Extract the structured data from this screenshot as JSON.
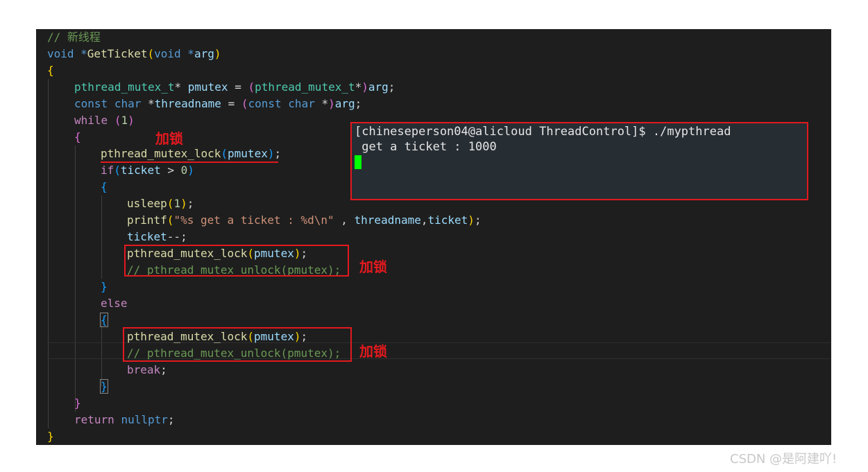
{
  "code": {
    "comment_new_thread": "// 新线程",
    "sig": [
      "void",
      " *",
      "GetTicket",
      "(",
      "void",
      " *",
      "arg",
      ")"
    ],
    "open_brace": "{",
    "l_mutex_decl": [
      "pthread_mutex_t",
      "* ",
      "pmutex",
      " = ",
      "(",
      "pthread_mutex_t",
      "*",
      ")",
      "arg",
      ";"
    ],
    "l_const": [
      "const",
      " ",
      "char",
      " *",
      "threadname",
      " = ",
      "(",
      "const",
      " ",
      "char",
      " *",
      ")",
      "arg",
      ";"
    ],
    "l_while": [
      "while",
      " ",
      "(",
      "1",
      ")"
    ],
    "while_open": "{",
    "l_lock1": [
      "pthread_mutex_lock",
      "(",
      "pmutex",
      ")",
      ";"
    ],
    "l_if": [
      "if",
      "(",
      "ticket",
      " > ",
      "0",
      ")"
    ],
    "if_open": "{",
    "l_usleep": [
      "usleep",
      "(",
      "1",
      ")",
      ";"
    ],
    "l_printf": [
      "printf",
      "(",
      "\"%s get a ticket : %d\\n\"",
      " , ",
      "threadname",
      ",",
      "ticket",
      ")",
      ";"
    ],
    "l_dec": [
      "ticket",
      "--;"
    ],
    "l_lock2": [
      "pthread_mutex_lock",
      "(",
      "pmutex",
      ")",
      ";"
    ],
    "l_unlock_comment1": "// pthread_mutex_unlock(pmutex);",
    "if_close": "}",
    "else_kw": "else",
    "else_open": "{",
    "l_lock3": [
      "pthread_mutex_lock",
      "(",
      "pmutex",
      ")",
      ";"
    ],
    "l_unlock_comment2": "// pthread_mutex_unlock(pmutex);",
    "l_break": [
      "break",
      ";"
    ],
    "else_close": "}",
    "while_close": "}",
    "l_return": [
      "return",
      " ",
      "nullptr",
      ";"
    ],
    "close_brace": "}"
  },
  "annotations": {
    "label1": "加锁",
    "label2": "加锁",
    "label3": "加锁"
  },
  "terminal": {
    "prompt_line": "[chineseperson04@alicloud ThreadControl]$ ./mypthread",
    "output_line": " get a ticket : 1000"
  },
  "watermark": "CSDN @是阿建吖!"
}
